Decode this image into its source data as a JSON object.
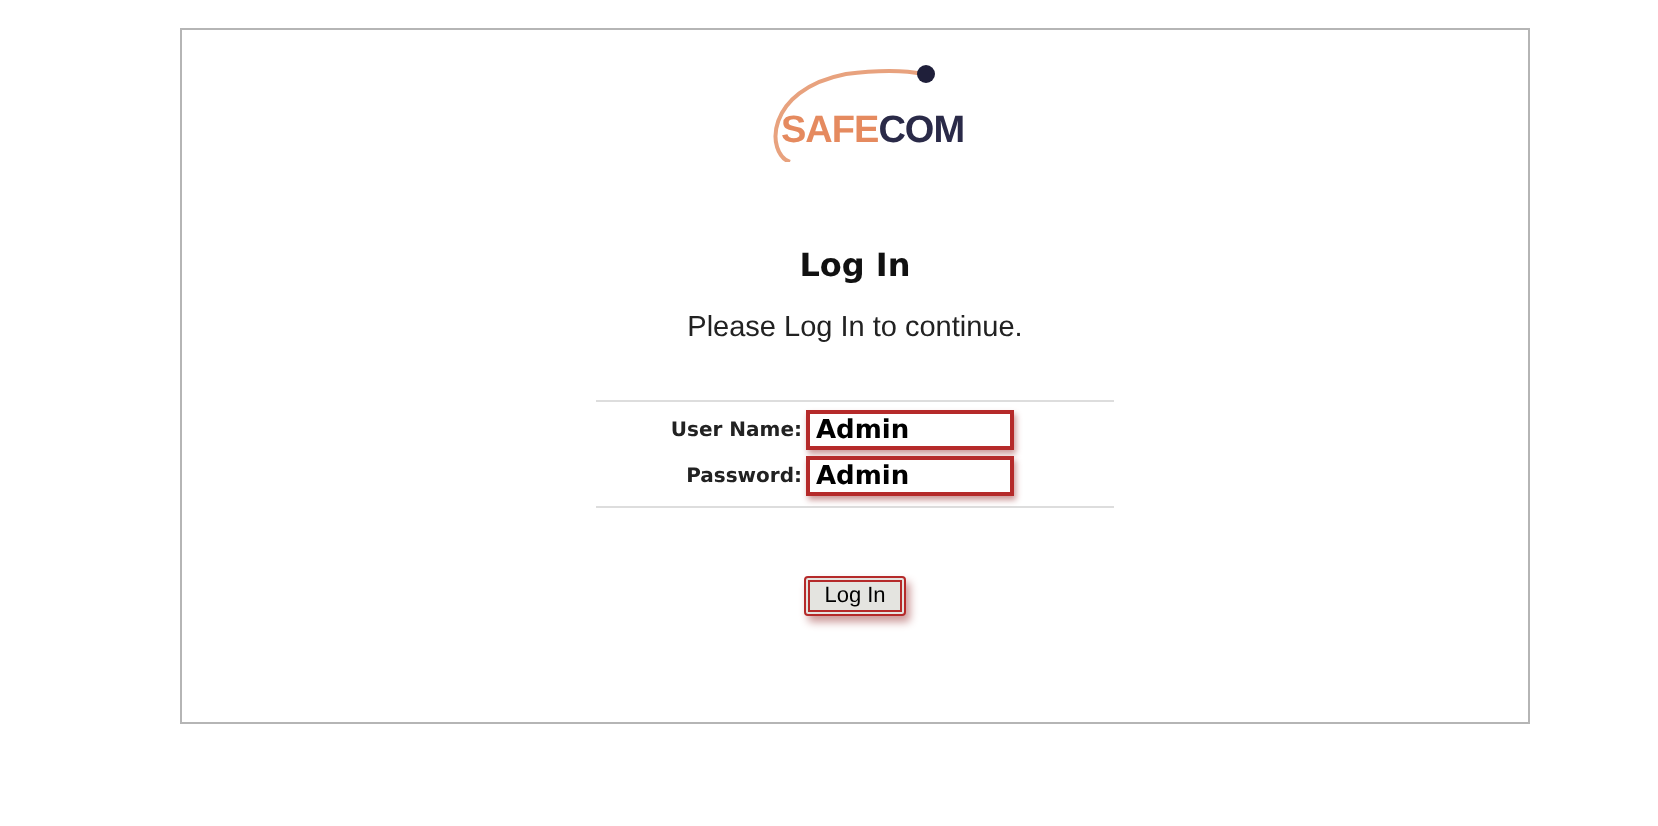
{
  "logo": {
    "accent": "SAFE",
    "rest": "COM"
  },
  "title": "Log In",
  "subtitle": "Please Log In to continue.",
  "fields": [
    {
      "label": "User Name:",
      "value": "Admin",
      "highlighted": true
    },
    {
      "label": "Password:",
      "value": "Admin",
      "highlighted": true
    }
  ],
  "button": {
    "label": "Log In",
    "highlighted": true
  }
}
